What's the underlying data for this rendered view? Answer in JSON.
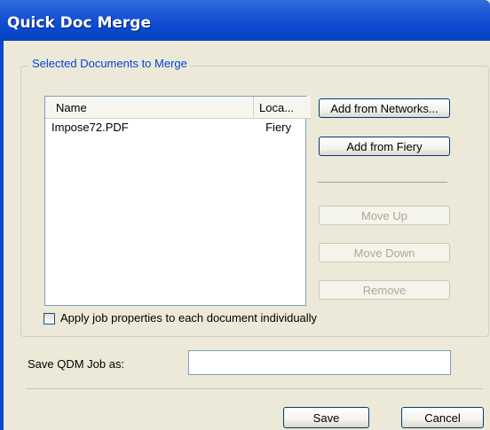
{
  "window": {
    "title": "Quick Doc Merge"
  },
  "group": {
    "label": "Selected Documents to Merge"
  },
  "list": {
    "columns": [
      "Name",
      "Loca..."
    ],
    "rows": [
      {
        "name": "Impose72.PDF",
        "location": "Fiery"
      }
    ]
  },
  "buttons": {
    "add_networks": "Add from Networks...",
    "add_fiery": "Add from Fiery",
    "move_up": "Move Up",
    "move_down": "Move Down",
    "remove": "Remove",
    "save": "Save",
    "cancel": "Cancel"
  },
  "checkbox": {
    "label": "Apply job properties to each document individually",
    "checked": false
  },
  "save_job": {
    "label": "Save QDM Job as:",
    "value": ""
  }
}
